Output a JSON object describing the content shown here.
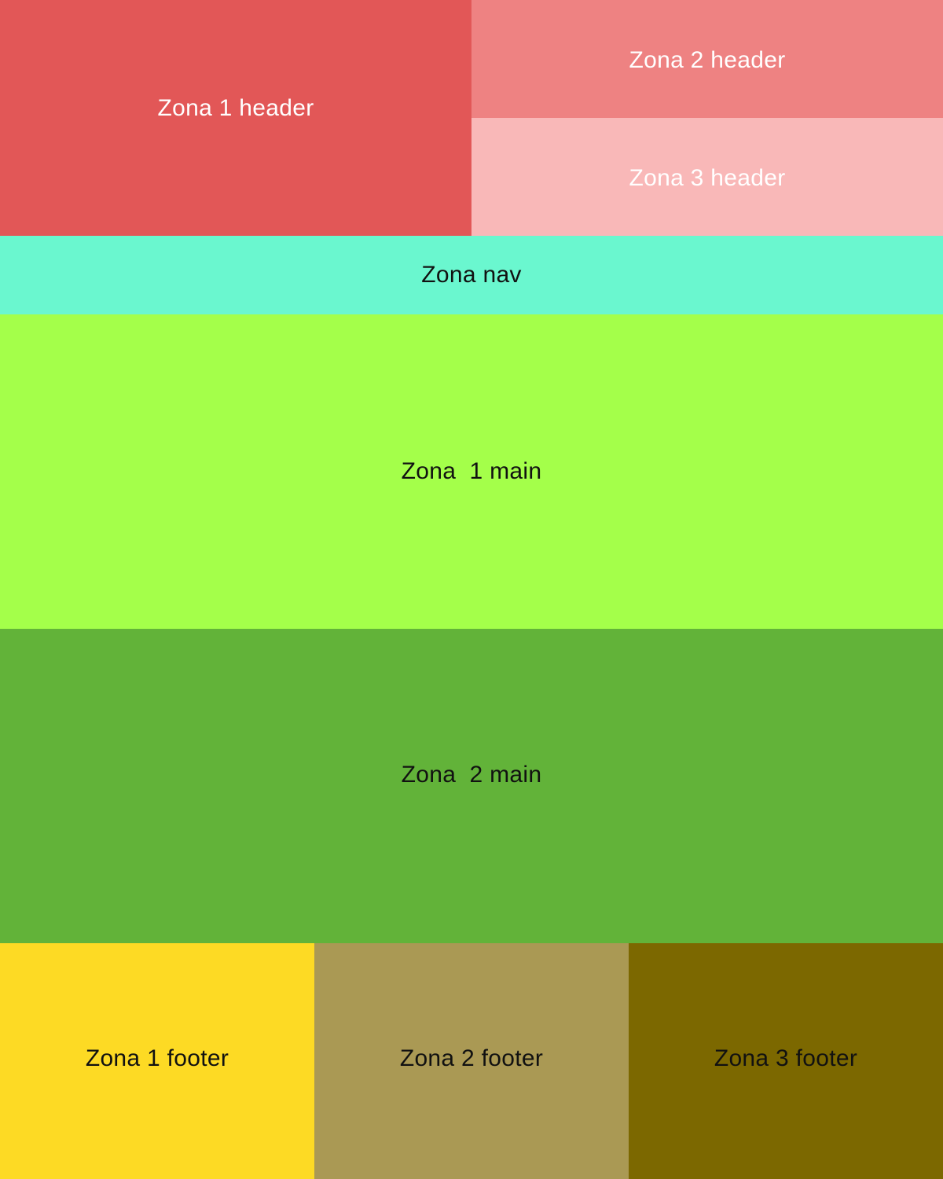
{
  "header": {
    "zone1": {
      "label": "Zona 1 header",
      "color": "#E25757"
    },
    "zone2": {
      "label": "Zona 2 header",
      "color": "#EE8282"
    },
    "zone3": {
      "label": "Zona 3 header",
      "color": "#F9B8B8"
    }
  },
  "nav": {
    "zone": {
      "label": "Zona nav",
      "color": "#6AF7CF"
    }
  },
  "main": {
    "zone1": {
      "label": "Zona  1 main",
      "color": "#A4FF4A"
    },
    "zone2": {
      "label": "Zona  2 main",
      "color": "#62B339"
    }
  },
  "footer": {
    "zone1": {
      "label": "Zona 1 footer",
      "color": "#FDDA24"
    },
    "zone2": {
      "label": "Zona 2 footer",
      "color": "#AA9954"
    },
    "zone3": {
      "label": "Zona 3 footer",
      "color": "#7C6800"
    }
  }
}
